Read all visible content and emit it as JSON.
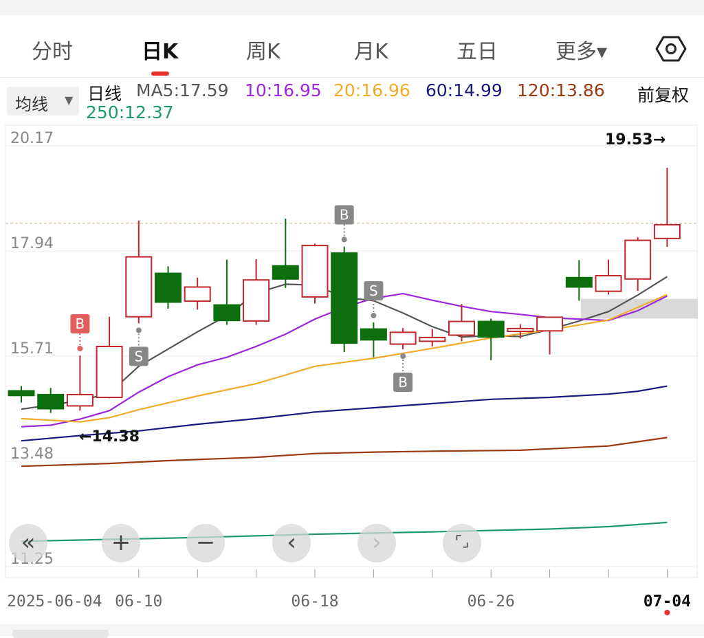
{
  "tabs": [
    {
      "label": "分时",
      "active": false
    },
    {
      "label": "日K",
      "active": true
    },
    {
      "label": "周K",
      "active": false
    },
    {
      "label": "月K",
      "active": false
    },
    {
      "label": "五日",
      "active": false
    },
    {
      "label": "更多▾",
      "active": false
    }
  ],
  "toolbar": {
    "ma_button_label": "均线",
    "period_label": "日线",
    "adjust_label": "前复权"
  },
  "ma_legend": {
    "ma5": "MA5:17.59",
    "ma10": "10:16.95",
    "ma20": "20:16.96",
    "ma60": "60:14.99",
    "ma120": "120:13.86",
    "ma250": "250:12.37"
  },
  "colors": {
    "up": "#c0262b",
    "down": "#0d6e0d",
    "ma5": "#555555",
    "ma10": "#9b27d9",
    "ma20": "#f0ac28",
    "ma60": "#1a1a7e",
    "ma120": "#9b3a10",
    "ma250": "#1e9a6a",
    "accent": "#e8302b"
  },
  "controls": [
    {
      "name": "scroll-left-fast-icon",
      "glyph": "«"
    },
    {
      "name": "zoom-in-icon",
      "glyph": "+"
    },
    {
      "name": "zoom-out-icon",
      "glyph": "−"
    },
    {
      "name": "scroll-left-icon",
      "glyph": "‹"
    },
    {
      "name": "scroll-right-icon",
      "glyph": "›"
    },
    {
      "name": "fullscreen-icon",
      "glyph": "⌜⌟"
    }
  ],
  "chart_data": {
    "type": "candlestick",
    "ylim": [
      11.25,
      20.17
    ],
    "y_ticks": [
      20.17,
      17.94,
      15.71,
      13.48,
      11.25
    ],
    "y_tick_labels": [
      "20.17",
      "17.94",
      "15.71",
      "13.48",
      "11.25"
    ],
    "x_labels": [
      "2025-06-04",
      "06-10",
      "06-18",
      "06-26",
      "07-04"
    ],
    "x_label_indices": [
      0,
      4,
      10,
      16,
      22
    ],
    "max_label": "19.53→",
    "min_label": "←14.38",
    "price_line": 18.35,
    "candles": [
      {
        "o": 14.8,
        "c": 14.7,
        "h": 14.9,
        "l": 14.55
      },
      {
        "o": 14.72,
        "c": 14.42,
        "h": 14.86,
        "l": 14.33
      },
      {
        "o": 14.48,
        "c": 14.72,
        "h": 15.55,
        "l": 14.38
      },
      {
        "o": 14.66,
        "c": 15.74,
        "h": 16.37,
        "l": 14.64
      },
      {
        "o": 16.37,
        "c": 17.64,
        "h": 18.41,
        "l": 16.23
      },
      {
        "o": 17.29,
        "c": 16.68,
        "h": 17.44,
        "l": 16.54
      },
      {
        "o": 16.7,
        "c": 17.0,
        "h": 17.2,
        "l": 16.52
      },
      {
        "o": 16.62,
        "c": 16.29,
        "h": 17.58,
        "l": 16.2
      },
      {
        "o": 16.28,
        "c": 17.15,
        "h": 17.59,
        "l": 16.2
      },
      {
        "o": 17.45,
        "c": 17.17,
        "h": 18.45,
        "l": 16.98
      },
      {
        "o": 16.79,
        "c": 17.88,
        "h": 17.92,
        "l": 16.65
      },
      {
        "o": 17.72,
        "c": 15.81,
        "h": 17.86,
        "l": 15.62
      },
      {
        "o": 16.11,
        "c": 15.88,
        "h": 16.25,
        "l": 15.51
      },
      {
        "o": 15.79,
        "c": 16.04,
        "h": 16.13,
        "l": 15.68
      },
      {
        "o": 15.85,
        "c": 15.93,
        "h": 16.11,
        "l": 15.74
      },
      {
        "o": 15.98,
        "c": 16.27,
        "h": 16.64,
        "l": 15.85
      },
      {
        "o": 16.27,
        "c": 15.94,
        "h": 16.33,
        "l": 15.45
      },
      {
        "o": 16.06,
        "c": 16.12,
        "h": 16.21,
        "l": 15.91
      },
      {
        "o": 16.07,
        "c": 16.36,
        "h": 16.36,
        "l": 15.57
      },
      {
        "o": 17.2,
        "c": 17.0,
        "h": 17.57,
        "l": 16.71
      },
      {
        "o": 16.91,
        "c": 17.24,
        "h": 17.58,
        "l": 16.84
      },
      {
        "o": 17.17,
        "c": 17.99,
        "h": 18.06,
        "l": 16.92
      },
      {
        "o": 18.03,
        "c": 18.32,
        "h": 19.53,
        "l": 17.85
      }
    ],
    "ma_series": [
      {
        "key": "ma5",
        "points": [
          [
            0,
            14.41
          ],
          [
            2,
            14.59
          ],
          [
            3,
            14.75
          ],
          [
            4,
            15.32
          ],
          [
            6,
            16.05
          ],
          [
            7,
            16.39
          ],
          [
            8,
            16.87
          ],
          [
            9,
            17.06
          ],
          [
            10,
            17.04
          ],
          [
            11,
            16.78
          ],
          [
            12,
            16.71
          ],
          [
            13,
            16.45
          ],
          [
            14,
            16.16
          ],
          [
            15,
            15.94
          ],
          [
            16,
            15.97
          ],
          [
            17,
            15.95
          ],
          [
            18,
            16.1
          ],
          [
            19,
            16.28
          ],
          [
            20,
            16.48
          ],
          [
            21,
            16.83
          ],
          [
            22,
            17.22
          ]
        ]
      },
      {
        "key": "ma10",
        "points": [
          [
            0,
            14.04
          ],
          [
            1,
            14.07
          ],
          [
            2,
            14.2
          ],
          [
            3,
            14.38
          ],
          [
            4,
            14.77
          ],
          [
            5,
            15.1
          ],
          [
            6,
            15.35
          ],
          [
            7,
            15.51
          ],
          [
            8,
            15.74
          ],
          [
            9,
            16.0
          ],
          [
            10,
            16.32
          ],
          [
            11,
            16.57
          ],
          [
            12,
            16.76
          ],
          [
            13,
            16.86
          ],
          [
            14,
            16.72
          ],
          [
            15,
            16.59
          ],
          [
            16,
            16.48
          ],
          [
            17,
            16.42
          ],
          [
            18,
            16.35
          ],
          [
            19,
            16.32
          ],
          [
            20,
            16.29
          ],
          [
            21,
            16.5
          ],
          [
            22,
            16.81
          ]
        ]
      },
      {
        "key": "ma20",
        "points": [
          [
            0,
            14.21
          ],
          [
            2,
            14.14
          ],
          [
            3,
            14.23
          ],
          [
            4,
            14.4
          ],
          [
            6,
            14.69
          ],
          [
            8,
            14.95
          ],
          [
            10,
            15.32
          ],
          [
            12,
            15.49
          ],
          [
            14,
            15.7
          ],
          [
            16,
            15.92
          ],
          [
            18,
            16.09
          ],
          [
            20,
            16.3
          ],
          [
            22,
            16.84
          ]
        ]
      },
      {
        "key": "ma60",
        "points": [
          [
            0,
            13.74
          ],
          [
            2,
            13.85
          ],
          [
            4,
            13.95
          ],
          [
            6,
            14.09
          ],
          [
            8,
            14.21
          ],
          [
            10,
            14.35
          ],
          [
            12,
            14.44
          ],
          [
            14,
            14.53
          ],
          [
            16,
            14.62
          ],
          [
            18,
            14.66
          ],
          [
            20,
            14.73
          ],
          [
            21,
            14.79
          ],
          [
            22,
            14.9
          ]
        ]
      },
      {
        "key": "ma120",
        "points": [
          [
            0,
            13.2
          ],
          [
            3,
            13.26
          ],
          [
            5,
            13.32
          ],
          [
            8,
            13.39
          ],
          [
            10,
            13.47
          ],
          [
            12,
            13.5
          ],
          [
            14,
            13.52
          ],
          [
            17,
            13.54
          ],
          [
            20,
            13.63
          ],
          [
            22,
            13.81
          ]
        ]
      },
      {
        "key": "ma250",
        "points": [
          [
            0,
            11.61
          ],
          [
            6,
            11.69
          ],
          [
            10,
            11.76
          ],
          [
            14,
            11.81
          ],
          [
            18,
            11.87
          ],
          [
            20,
            11.92
          ],
          [
            22,
            12.01
          ]
        ]
      }
    ],
    "signals": [
      {
        "i": 2,
        "text": "B",
        "pos": "above",
        "color": "#e25d5d"
      },
      {
        "i": 4,
        "text": "S",
        "pos": "below",
        "color": "#888888"
      },
      {
        "i": 11,
        "text": "B",
        "pos": "above",
        "color": "#888888"
      },
      {
        "i": 12,
        "text": "S",
        "pos": "above",
        "color": "#888888"
      },
      {
        "i": 13,
        "text": "B",
        "pos": "below",
        "color": "#888888"
      }
    ]
  }
}
